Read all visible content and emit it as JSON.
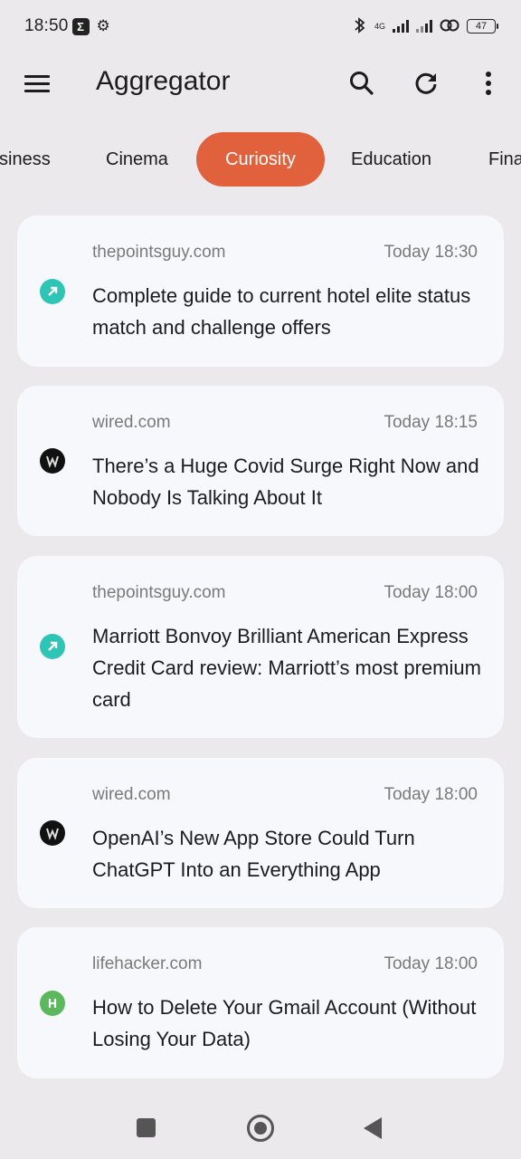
{
  "status_bar": {
    "time": "18:50",
    "network": "4G",
    "battery": "47"
  },
  "app_bar": {
    "title": "Aggregator",
    "menu_icon": "menu-icon",
    "search_icon": "search-icon",
    "refresh_icon": "refresh-icon",
    "more_icon": "more-vert-icon"
  },
  "tabs": [
    {
      "label": "Business",
      "visible_text": "siness"
    },
    {
      "label": "Cinema",
      "visible_text": "Cinema"
    },
    {
      "label": "Curiosity",
      "visible_text": "Curiosity",
      "active": true
    },
    {
      "label": "Education",
      "visible_text": "Education"
    },
    {
      "label": "Finance",
      "visible_text": "Fina"
    }
  ],
  "colors": {
    "accent": "#e0613c",
    "background": "#ece9ec",
    "card": "#f7f8fb",
    "thepointsguy": "#2ec4b6",
    "wired": "#111111",
    "lifehacker": "#5cb85c"
  },
  "articles": [
    {
      "source": "thepointsguy.com",
      "icon": "thepointsguy-icon",
      "time": "Today 18:30",
      "title": "Complete guide to current hotel elite status match and challenge offers"
    },
    {
      "source": "wired.com",
      "icon": "wired-icon",
      "time": "Today 18:15",
      "title": "There’s a Huge Covid Surge Right Now and Nobody Is Talking About It"
    },
    {
      "source": "thepointsguy.com",
      "icon": "thepointsguy-icon",
      "time": "Today 18:00",
      "title": "Marriott Bonvoy Brilliant American Express Credit Card review: Marriott’s most premium card"
    },
    {
      "source": "wired.com",
      "icon": "wired-icon",
      "time": "Today 18:00",
      "title": "OpenAI’s New App Store Could Turn ChatGPT Into an Everything App"
    },
    {
      "source": "lifehacker.com",
      "icon": "lifehacker-icon",
      "time": "Today 18:00",
      "title": "How to Delete Your Gmail Account (Without Losing Your Data)"
    }
  ],
  "nav_bar": {
    "recents_icon": "recents-icon",
    "home_icon": "home-icon",
    "back_icon": "back-icon"
  }
}
